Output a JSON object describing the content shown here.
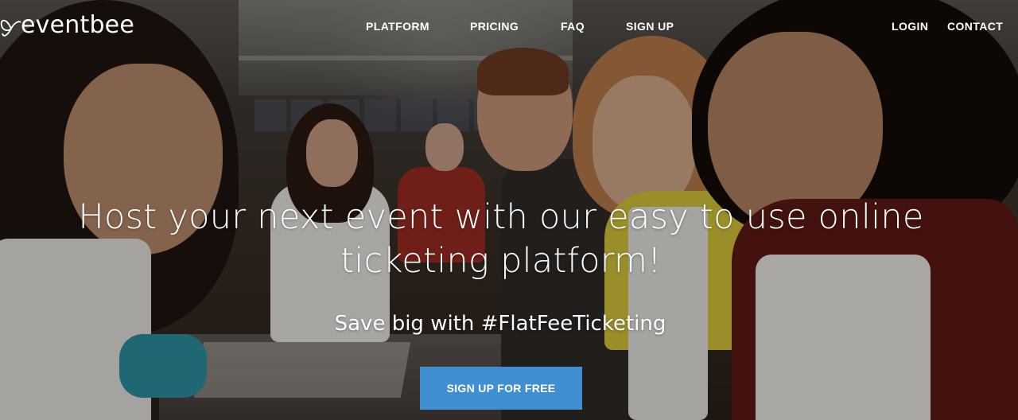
{
  "brand": {
    "logo_text": "eventbee",
    "icon": "butterfly-logo-icon"
  },
  "nav": {
    "platform": "PLATFORM",
    "pricing": "PRICING",
    "faq": "FAQ",
    "signup": "SIGN UP",
    "login": "LOGIN",
    "contact": "CONTACT"
  },
  "hero": {
    "headline_line1": "Host your next event with our easy to use online",
    "headline_line2": "ticketing platform!",
    "subheadline": "Save big with #FlatFeeTicketing",
    "cta_label": "SIGN UP FOR FREE",
    "background_image": "photo of people chopping vegetables in a cooking class kitchen"
  },
  "colors": {
    "cta_background": "#3f8fd2",
    "text": "#ffffff"
  }
}
